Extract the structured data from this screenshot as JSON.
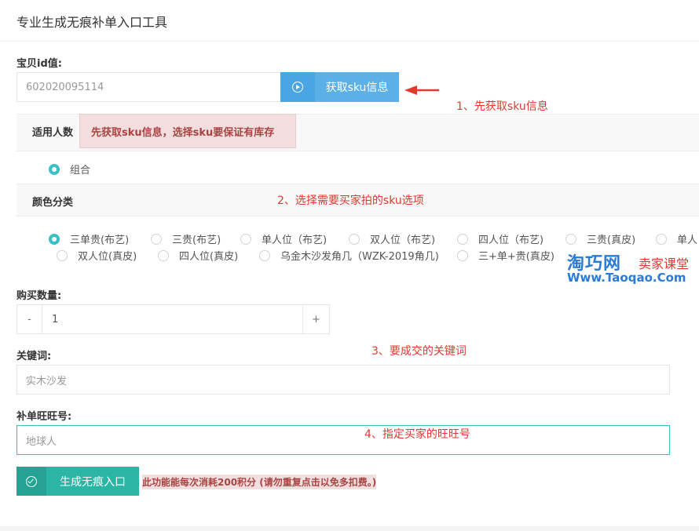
{
  "page": {
    "title": "专业生成无痕补单入口工具"
  },
  "item_id": {
    "label": "宝贝id值:",
    "value": "602020095114"
  },
  "fetch_button": {
    "label": "获取sku信息"
  },
  "annotations": {
    "a1": "1、先获取sku信息",
    "a2": "2、选择需要买家拍的sku选项",
    "a3": "3、要成交的关键词",
    "a4": "4、指定买家的旺旺号"
  },
  "persons": {
    "label": "适用人数",
    "warning": "先获取sku信息，选择sku要保证有库存",
    "option": "组合"
  },
  "color": {
    "label": "颜色分类",
    "options": [
      "三单贵(布艺)",
      "三贵(布艺)",
      "单人位（布艺)",
      "双人位（布艺)",
      "四人位（布艺)",
      "三贵(真皮)",
      "单人",
      "双人位(真皮)",
      "四人位(真皮)",
      "乌金木沙发角几（WZK-2019角几)",
      "三+单+贵(真皮)"
    ],
    "selected_index": 0
  },
  "quantity": {
    "label": "购买数量:",
    "minus": "-",
    "value": "1",
    "plus": "+"
  },
  "keyword": {
    "label": "关键词:",
    "placeholder": "实木沙发"
  },
  "wangwang": {
    "label": "补单旺旺号:",
    "placeholder": "地球人"
  },
  "generate_button": {
    "label": "生成无痕入口"
  },
  "cost_note": "此功能能每次消耗200积分 (请勿重复点击以免多扣费。)",
  "watermark": {
    "brand": "淘巧网",
    "tag": "卖家课堂",
    "url": "Www.Taoqao.Com"
  },
  "colors": {
    "accent": "#3bc0c3",
    "blue_button": "#5cb0e8",
    "green_button": "#2bb5a4",
    "annotation_red": "#e03a30"
  }
}
